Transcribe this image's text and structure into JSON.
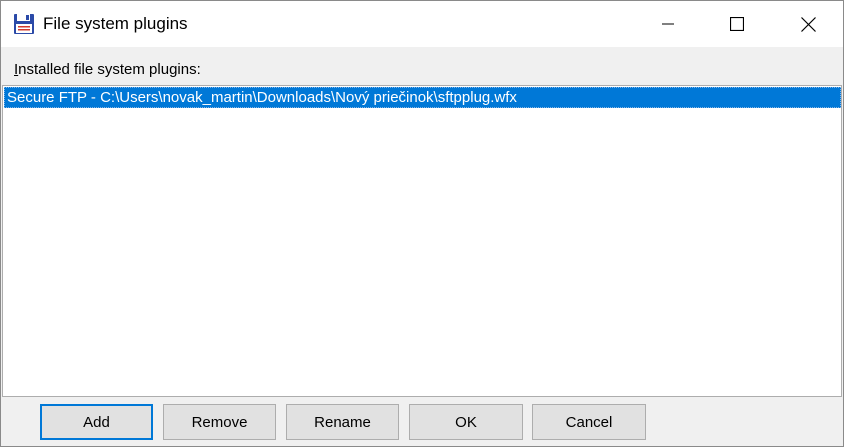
{
  "window": {
    "title": "File system plugins",
    "icon": "floppy-disk-icon",
    "controls": {
      "minimize": "minimize-icon",
      "maximize": "maximize-icon",
      "close": "close-icon"
    }
  },
  "list": {
    "label_mnemonic": "I",
    "label_rest": "nstalled file system plugins:",
    "items": [
      {
        "label": "Secure FTP  -  C:\\Users\\novak_martin\\Downloads\\Nový priečinok\\sftpplug.wfx",
        "selected": true
      }
    ]
  },
  "buttons": {
    "add": "Add",
    "remove": "Remove",
    "rename": "Rename",
    "ok": "OK",
    "cancel": "Cancel"
  },
  "colors": {
    "selection": "#0078d7",
    "button_face": "#e1e1e1",
    "dialog_bg": "#f0f0f0"
  }
}
